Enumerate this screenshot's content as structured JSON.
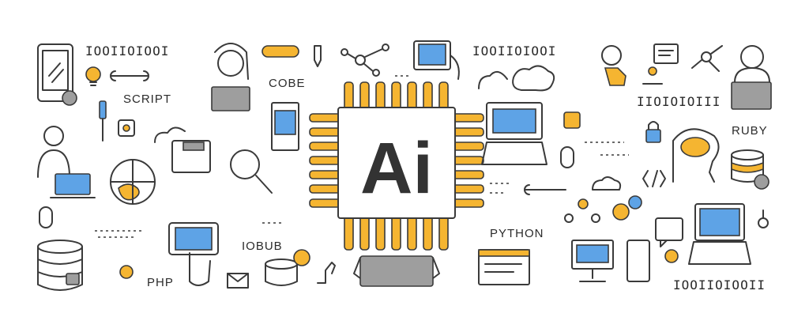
{
  "center": {
    "label": "Ai"
  },
  "binary": {
    "top_left": "IOOIIOIOOI",
    "top_center": "IOOIIOIOOI",
    "right_mid": "IIOIOIOIII",
    "bottom_right": "IOOIIOIOOII"
  },
  "labels": {
    "script": "SCRIPT",
    "code": "COBE",
    "ruby": "RUBY",
    "python": "PYTHON",
    "json": "IOBUB",
    "php": "PHP"
  },
  "colors": {
    "accent_yellow": "#f5b531",
    "accent_blue": "#5ea3e6",
    "gray": "#9e9e9e",
    "line": "#3a3a3a"
  }
}
